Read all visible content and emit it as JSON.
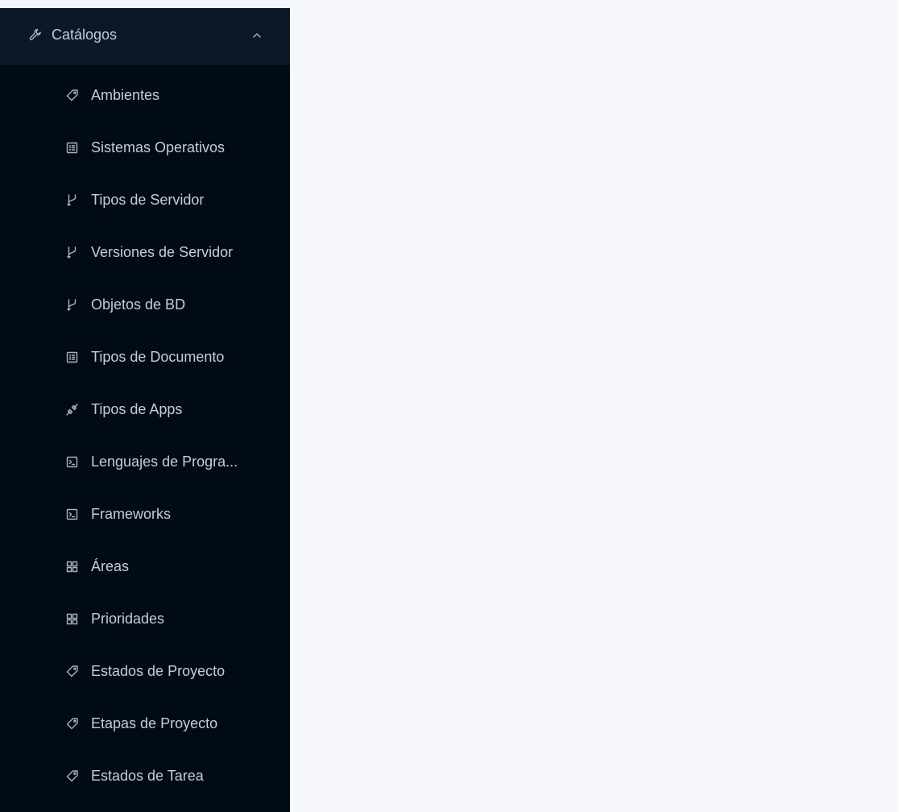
{
  "sidebar": {
    "submenu": {
      "title": "Catálogos",
      "icon": "wrench-icon",
      "expanded": true
    },
    "items": [
      {
        "label": "Ambientes",
        "icon": "tag-icon"
      },
      {
        "label": "Sistemas Operativos",
        "icon": "list-box-icon"
      },
      {
        "label": "Tipos de Servidor",
        "icon": "branch-icon"
      },
      {
        "label": "Versiones de Servidor",
        "icon": "branch-icon"
      },
      {
        "label": "Objetos de BD",
        "icon": "branch-icon"
      },
      {
        "label": "Tipos de Documento",
        "icon": "list-box-icon"
      },
      {
        "label": "Tipos de Apps",
        "icon": "api-icon"
      },
      {
        "label": "Lenguajes de Progra...",
        "icon": "terminal-icon"
      },
      {
        "label": "Frameworks",
        "icon": "terminal-icon"
      },
      {
        "label": "Áreas",
        "icon": "grid-icon"
      },
      {
        "label": "Prioridades",
        "icon": "grid-icon"
      },
      {
        "label": "Estados de Proyecto",
        "icon": "tag-icon"
      },
      {
        "label": "Etapas de Proyecto",
        "icon": "tag-icon"
      },
      {
        "label": "Estados de Tarea",
        "icon": "tag-icon"
      }
    ]
  },
  "colors": {
    "sidebar_bg": "#010a17",
    "submenu_header_bg": "#0a1828",
    "content_bg": "#f5f7fa",
    "text": "#c8cdd4"
  }
}
